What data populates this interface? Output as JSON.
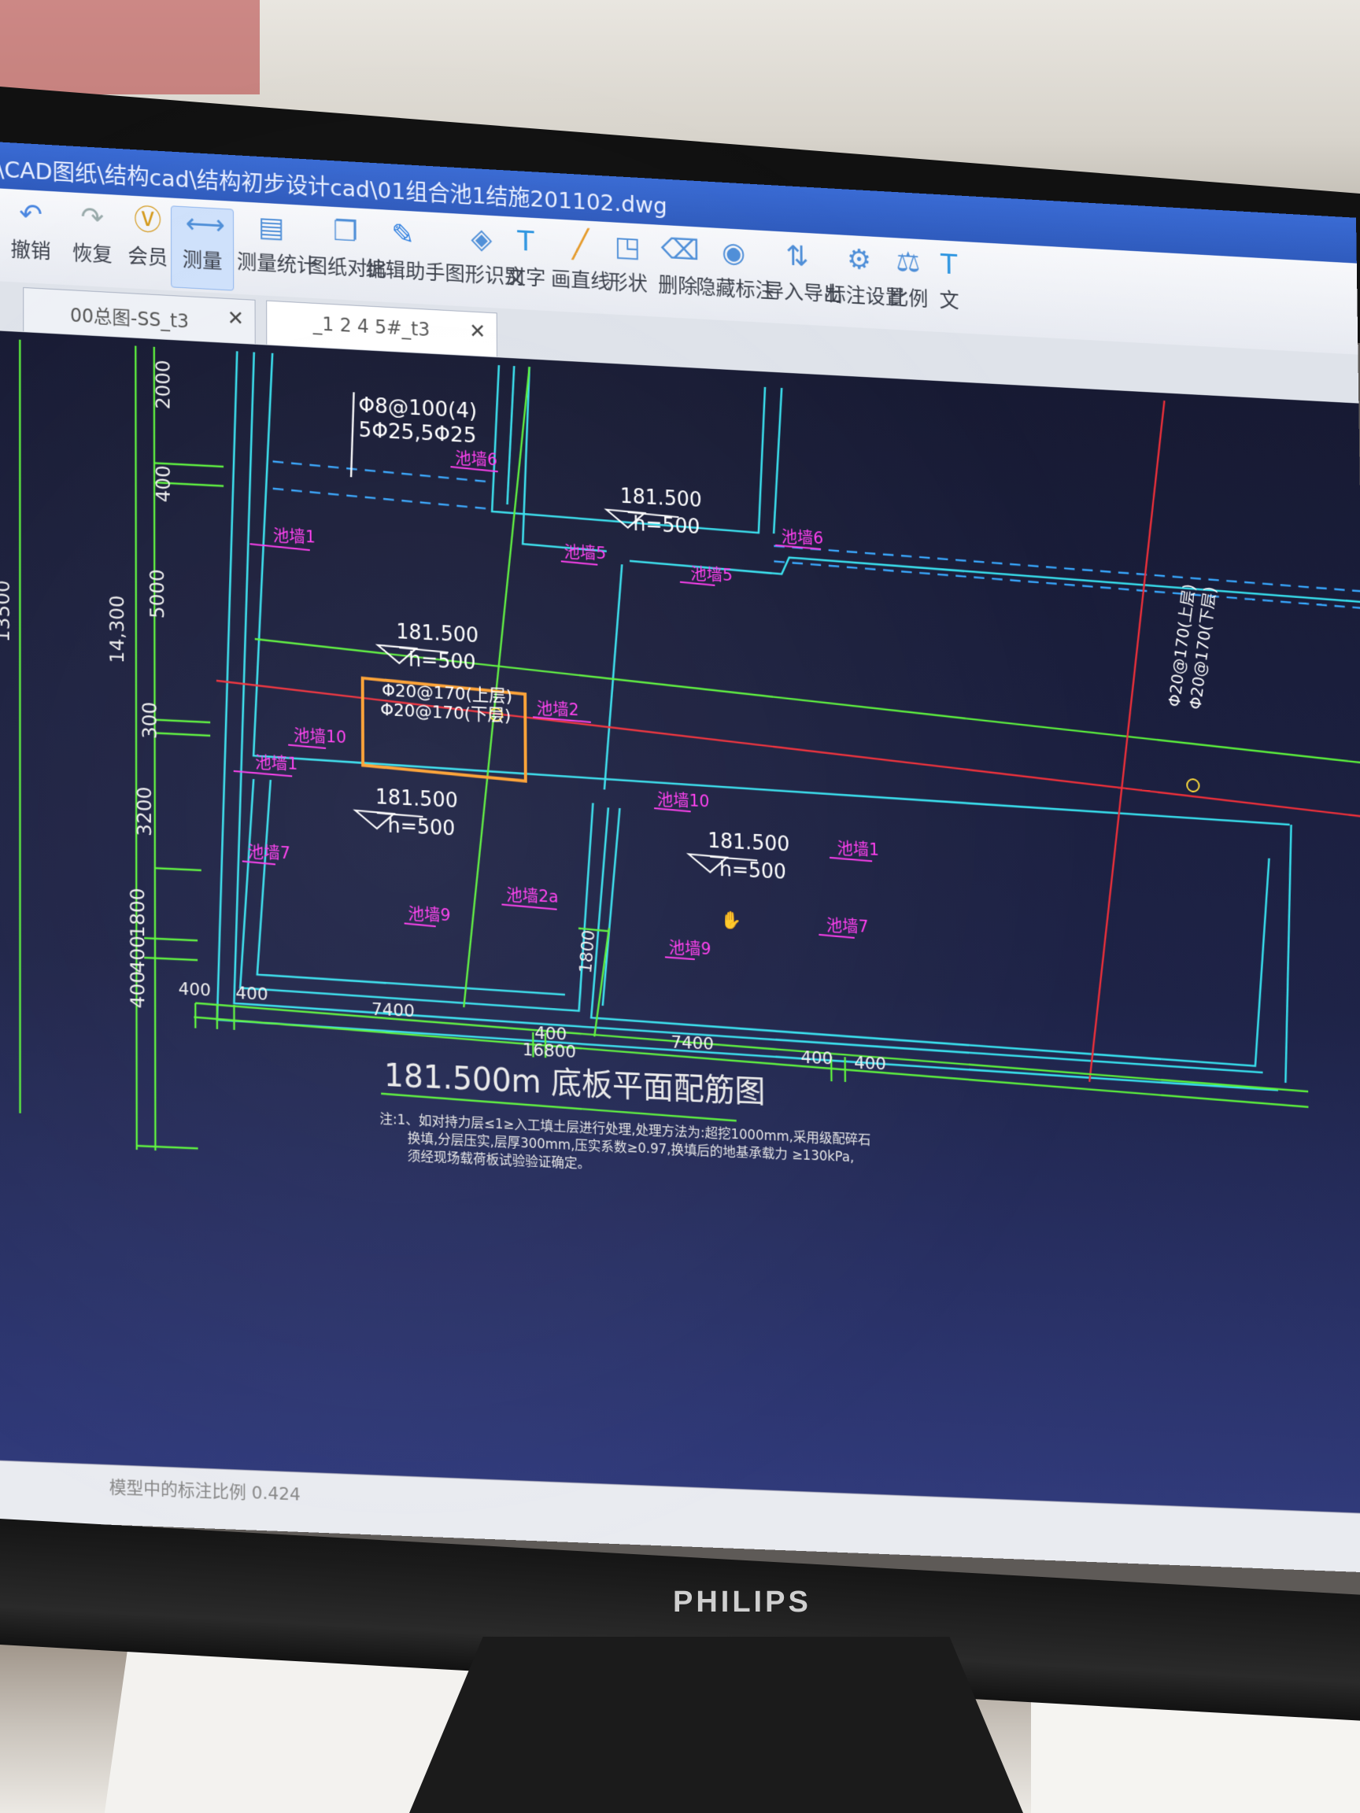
{
  "window": {
    "title": "\\CAD图纸\\结构cad\\结构初步设计cad\\01组合池1结施201102.dwg"
  },
  "toolbar": {
    "items": [
      {
        "label": "撤销",
        "icon": "undo-icon"
      },
      {
        "label": "恢复",
        "icon": "redo-icon"
      },
      {
        "label": "会员",
        "icon": "vip-icon"
      },
      {
        "label": "测量",
        "icon": "ruler-icon",
        "active": true
      },
      {
        "label": "测量统计",
        "icon": "measure-stats-icon"
      },
      {
        "label": "图纸对比",
        "icon": "compare-icon"
      },
      {
        "label": "编辑助手",
        "icon": "cad-edit-icon"
      },
      {
        "label": "图形识别",
        "icon": "shape-recognize-icon"
      },
      {
        "label": "文字",
        "icon": "text-icon"
      },
      {
        "label": "画直线",
        "icon": "line-icon"
      },
      {
        "label": "形状",
        "icon": "shapes-icon"
      },
      {
        "label": "删除",
        "icon": "eraser-icon"
      },
      {
        "label": "隐藏标注",
        "icon": "eye-icon"
      },
      {
        "label": "导入导出",
        "icon": "import-export-icon"
      },
      {
        "label": "标注设置",
        "icon": "settings-icon"
      },
      {
        "label": "比例",
        "icon": "scale-icon"
      },
      {
        "label": "文",
        "icon": "text-icon"
      }
    ]
  },
  "tabs": [
    {
      "label": "00总图-SS_t3"
    },
    {
      "label": "_1 2 4 5#_t3",
      "active": true
    }
  ],
  "drawing": {
    "rebar_top_note": "Φ8@100(4)",
    "rebar_top_note2": "5Φ25,5Φ25",
    "elevation": "181.500",
    "elevation_alt": "181.500",
    "slab_height": "h=500",
    "selected_rebar_top": "Φ20@170(上层)",
    "selected_rebar_bottom": "Φ20@170(下层)",
    "vertical_rebar_top": "Φ20@170(上层)",
    "vertical_rebar_bottom": "Φ20@170(下层)",
    "wall_labels": {
      "w1": "池墙1",
      "w2": "池墙2",
      "w2a": "池墙2a",
      "w5": "池墙5",
      "w6": "池墙6",
      "w7": "池墙7",
      "w9": "池墙9",
      "w10": "池墙10"
    },
    "dims_left": [
      "2000",
      "400",
      "5000",
      "300",
      "3200",
      "1800",
      "400",
      "400"
    ],
    "dim_total_left": "14,300",
    "dim_far_left": "13500",
    "dims_bottom": [
      "400",
      "400",
      "7400",
      "400",
      "7400",
      "400",
      "400"
    ],
    "dim_total_bottom": "16800",
    "dim_inner": "1800",
    "dim_right_edge": "400",
    "plan_title": "181.500m 底板平面配筋图",
    "note_line1": "注:1、如对持力层≤1≥入工填土层进行处理,处理方法为:超挖1000mm,采用级配碎石",
    "note_line2": "换填,分层压实,层厚300mm,压实系数≥0.97,换填后的地基承载力 ≥130kPa,",
    "note_line3": "须经现场载荷板试验验证确定。"
  },
  "status": {
    "text": "模型中的标注比例 0.424"
  },
  "monitor": {
    "brand": "PHILIPS"
  },
  "colors": {
    "cyan": "#38e0ee",
    "green": "#5cf23c",
    "red": "#f0303a",
    "magenta": "#ff3cf0",
    "white": "#f2f2f2",
    "selection": "#ffa030"
  }
}
